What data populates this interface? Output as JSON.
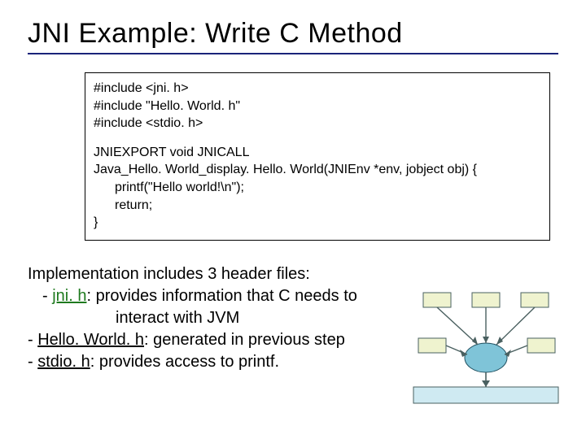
{
  "title": "JNI Example: Write C Method",
  "code": {
    "inc1": "#include <jni. h>",
    "inc2": "#include \"Hello. World. h\"",
    "inc3": "#include <stdio. h>",
    "l1": "JNIEXPORT void JNICALL",
    "l2": "Java_Hello. World_display. Hello. World(JNIEnv *env, jobject obj) {",
    "l3": "printf(\"Hello world!\\n\");",
    "l4": "return;",
    "l5": "}"
  },
  "body": {
    "intro": "Implementation includes 3 header files:",
    "dash": " - ",
    "dash2": "- ",
    "jni_name": "jni. h",
    "jni_desc": ": provides information that C needs to",
    "jni_desc2": "interact with JVM",
    "hw_name": "Hello. World. h",
    "hw_desc": ": generated in previous step",
    "std_name": "stdio. h",
    "std_desc": ": provides access to printf."
  },
  "icons": {
    "diagram": "flow-diagram-icon"
  }
}
